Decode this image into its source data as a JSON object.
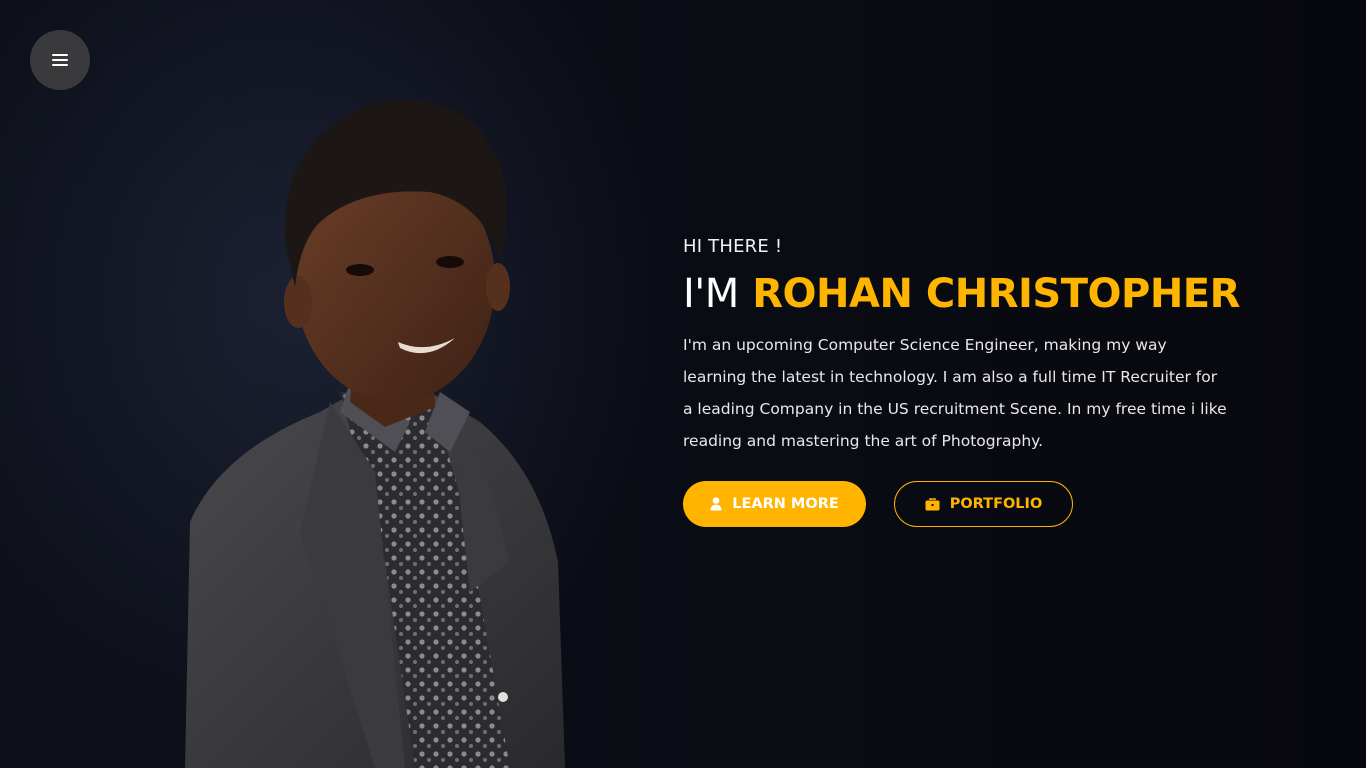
{
  "menu": {
    "icon": "hamburger-icon"
  },
  "hero": {
    "greeting": "HI THERE !",
    "name_prefix": "I'M",
    "name": "ROHAN CHRISTOPHER",
    "bio": "I'm an upcoming Computer Science Engineer, making my way learning the latest in technology. I am also a full time IT Recruiter for a leading Company in the US recruitment Scene. In my free time i like reading and mastering the art of Photography.",
    "buttons": {
      "learn_more": {
        "label": "LEARN MORE",
        "icon": "user-icon"
      },
      "portfolio": {
        "label": "PORTFOLIO",
        "icon": "briefcase-icon"
      }
    }
  },
  "colors": {
    "accent": "#ffb400",
    "background": "#0b0d14",
    "menu_button": "#3a3a3d"
  }
}
